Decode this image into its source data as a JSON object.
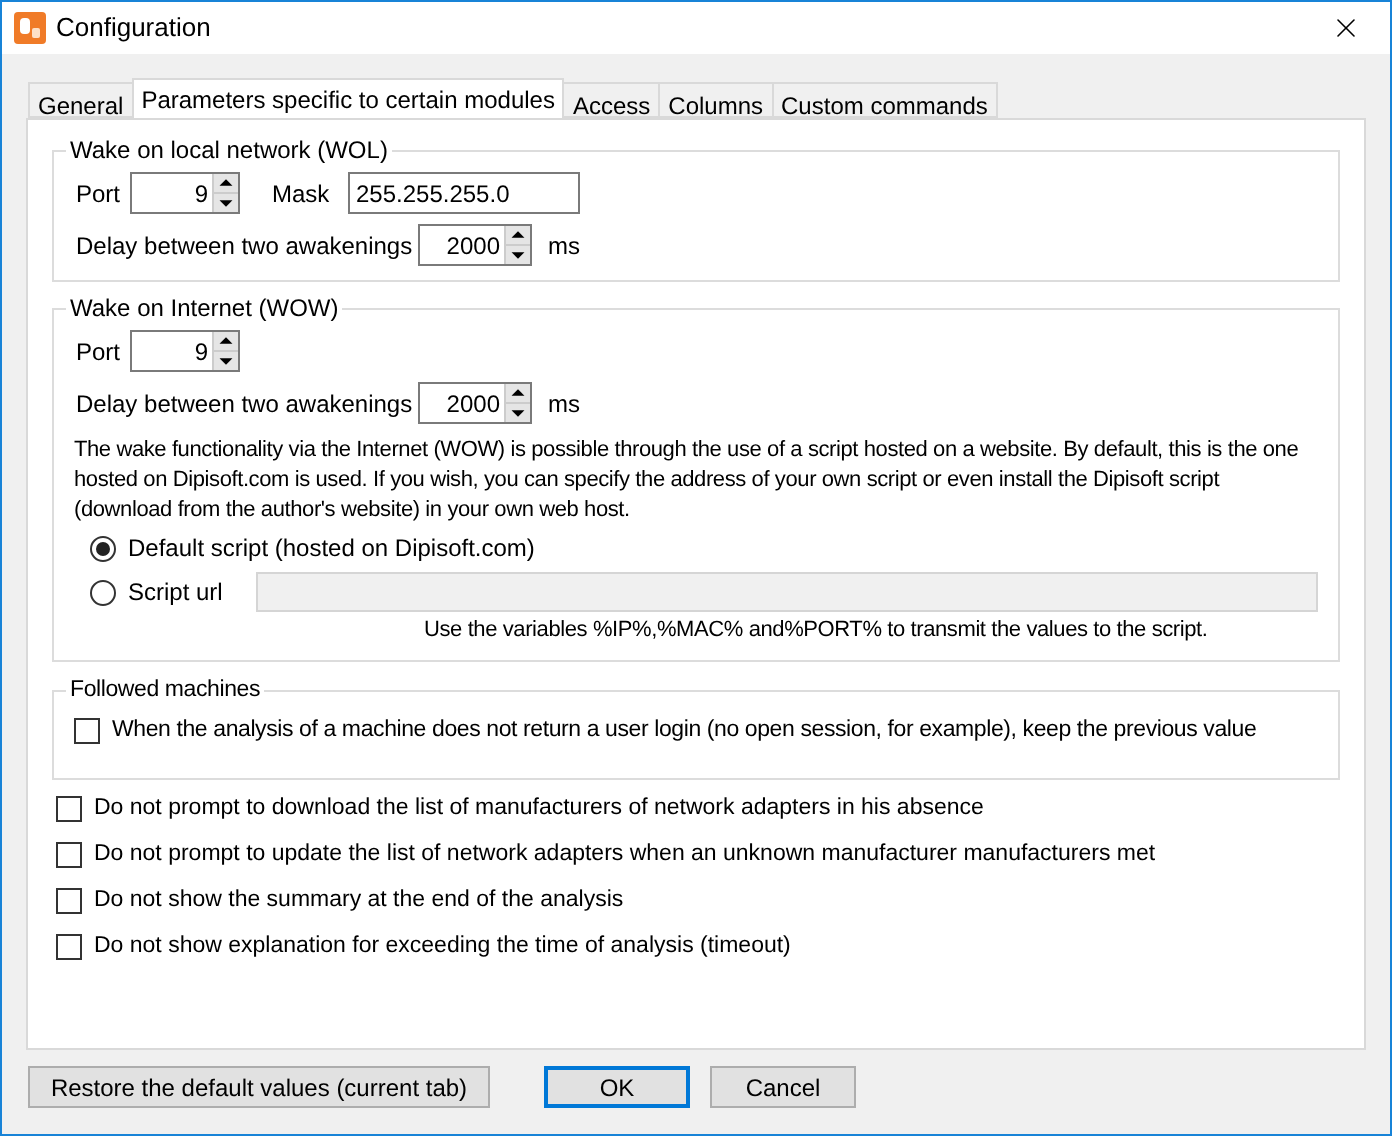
{
  "window": {
    "title": "Configuration"
  },
  "tabs": [
    {
      "label": "General",
      "selected": false
    },
    {
      "label": "Parameters specific to certain modules",
      "selected": true
    },
    {
      "label": "Access",
      "selected": false
    },
    {
      "label": "Columns",
      "selected": false
    },
    {
      "label": "Custom commands",
      "selected": false
    }
  ],
  "wol": {
    "title": "Wake on local network (WOL)",
    "port_label": "Port",
    "port": "9",
    "mask_label": "Mask",
    "mask": "255.255.255.0",
    "delay_label": "Delay between two awakenings",
    "delay": "2000",
    "unit": "ms"
  },
  "wow": {
    "title": "Wake on Internet (WOW)",
    "port_label": "Port",
    "port": "9",
    "delay_label": "Delay between two awakenings",
    "delay": "2000",
    "unit": "ms",
    "description": "The wake functionality via the Internet (WOW) is possible through the use of a script hosted on a website. By default, this is the one hosted on Dipisoft.com is used. If you wish, you can specify the address of your own script or even install the Dipisoft script (download from the author's website) in your own web host.",
    "options": [
      {
        "label": "Default script (hosted on Dipisoft.com)",
        "selected": true
      },
      {
        "label": "Script url",
        "selected": false
      }
    ],
    "url_field": {
      "disabled": true
    },
    "hint": "Use the variables %IP%,%MAC% and%PORT% to transmit the values to the script."
  },
  "followed": {
    "title": "Followed machines",
    "options": [
      {
        "label": "When the analysis of a machine does not return a user login (no open session, for example), keep the previous value",
        "checked": false
      }
    ]
  },
  "options": [
    {
      "label": "Do not prompt to download the list of manufacturers of network adapters in his absence",
      "checked": false
    },
    {
      "label": "Do not prompt to update the list of network adapters when an unknown manufacturer manufacturers met",
      "checked": false
    },
    {
      "label": "Do not show the summary at the end of the analysis",
      "checked": false
    },
    {
      "label": "Do not show explanation for exceeding the time of analysis (timeout)",
      "checked": false
    }
  ],
  "buttons": [
    {
      "label": "Restore the default values (current tab)",
      "default": false
    },
    {
      "label": "OK",
      "default": true
    },
    {
      "label": "Cancel",
      "default": false
    }
  ]
}
